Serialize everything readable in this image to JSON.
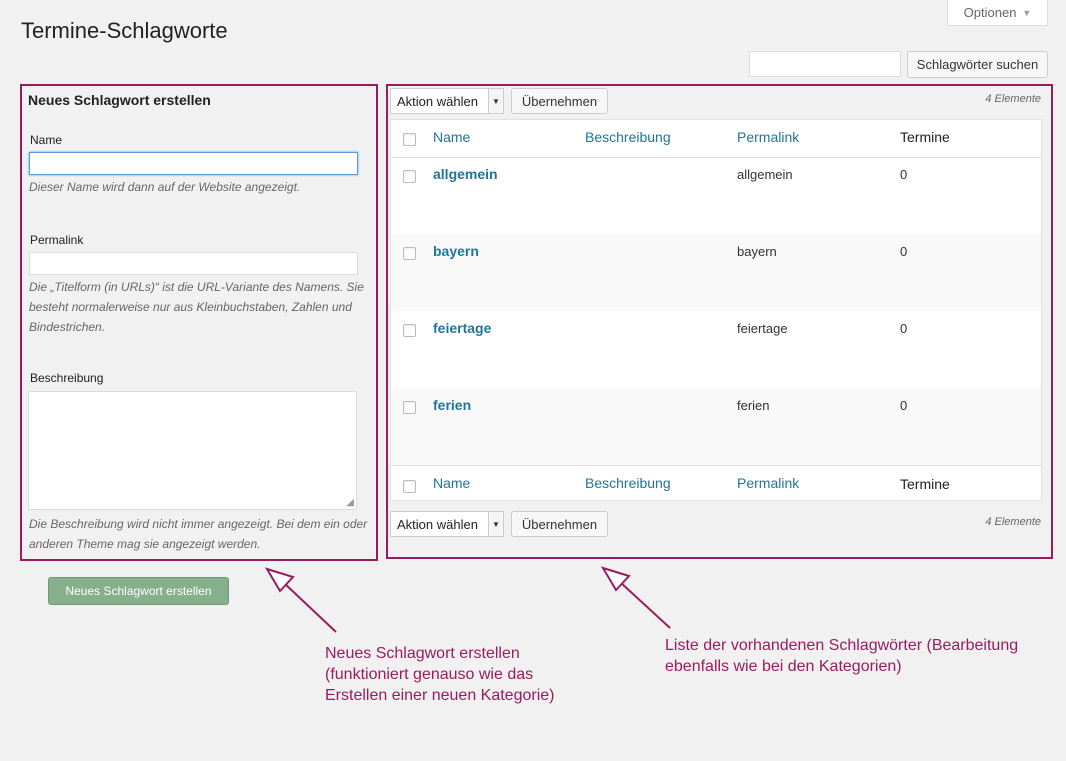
{
  "header": {
    "title": "Termine-Schlagworte",
    "options_label": "Optionen",
    "search_button": "Schlagwörter suchen",
    "search_value": ""
  },
  "form": {
    "heading": "Neues Schlagwort erstellen",
    "name_label": "Name",
    "name_value": "",
    "name_hint": "Dieser Name wird dann auf der Website angezeigt.",
    "permalink_label": "Permalink",
    "permalink_value": "",
    "permalink_hint": "Die „Titelform (in URLs)“ ist die URL-Variante des Namens. Sie besteht normalerweise nur aus Kleinbuchstaben, Zahlen und Bindestrichen.",
    "description_label": "Beschreibung",
    "description_value": "",
    "description_hint": "Die Beschreibung wird nicht immer angezeigt. Bei dem ein oder anderen Theme mag sie angezeigt werden.",
    "submit_label": "Neues Schlagwort erstellen"
  },
  "table": {
    "bulk_action_label": "Aktion wählen",
    "apply_label": "Übernehmen",
    "item_count": "4 Elemente",
    "columns": [
      "Name",
      "Beschreibung",
      "Permalink",
      "Termine"
    ],
    "rows": [
      {
        "name": "allgemein",
        "description": "",
        "permalink": "allgemein",
        "count": "0"
      },
      {
        "name": "bayern",
        "description": "",
        "permalink": "bayern",
        "count": "0"
      },
      {
        "name": "feiertage",
        "description": "",
        "permalink": "feiertage",
        "count": "0"
      },
      {
        "name": "ferien",
        "description": "",
        "permalink": "ferien",
        "count": "0"
      }
    ]
  },
  "annotations": {
    "left_callout": "Neues Schlagwort erstellen (funktioniert genauso wie das Erstellen einer neuen Kategorie)",
    "right_callout": "Liste der vorhandenen Schlagwörter (Bearbeitung ebenfalls wie bei den Kategorien)"
  },
  "colors": {
    "annotation": "#9b1b5f",
    "link": "#21759b",
    "submit_button": "#86af8b",
    "background": "#f1f1f1"
  }
}
